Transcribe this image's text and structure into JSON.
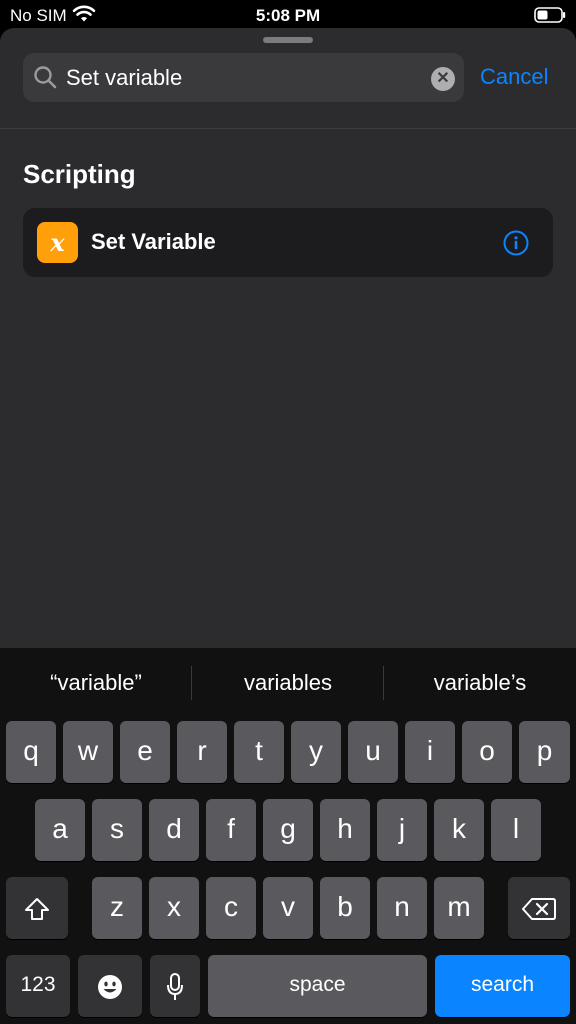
{
  "status_bar": {
    "carrier": "No SIM",
    "time": "5:08 PM"
  },
  "search": {
    "value": "Set variable",
    "cancel_label": "Cancel"
  },
  "section": {
    "title": "Scripting"
  },
  "action": {
    "icon_glyph": "x",
    "label": "Set Variable"
  },
  "keyboard": {
    "suggestions": [
      "“variable”",
      "variables",
      "variable’s"
    ],
    "row1": [
      "q",
      "w",
      "e",
      "r",
      "t",
      "y",
      "u",
      "i",
      "o",
      "p"
    ],
    "row2": [
      "a",
      "s",
      "d",
      "f",
      "g",
      "h",
      "j",
      "k",
      "l"
    ],
    "row3": [
      "z",
      "x",
      "c",
      "v",
      "b",
      "n",
      "m"
    ],
    "numbers_label": "123",
    "space_label": "space",
    "search_label": "search"
  },
  "colors": {
    "accent": "#0a84ff",
    "action_icon_bg": "#ff9f0a",
    "sheet_bg": "#2c2c2e"
  }
}
